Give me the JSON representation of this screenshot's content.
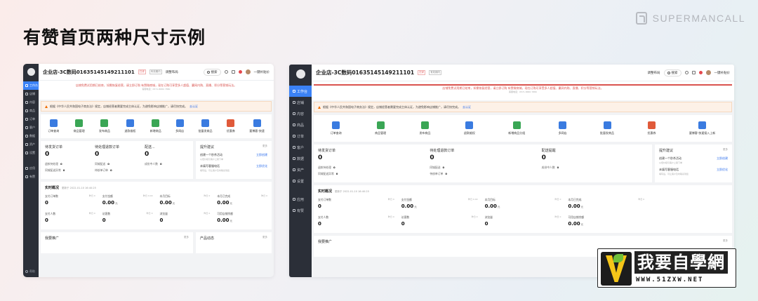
{
  "slide": {
    "title": "有赞首页两种尺寸示例",
    "brand": "SUPERMANCALL"
  },
  "colors": {
    "sidebar_bg": "#2b2f38",
    "sidebar_active": "#3b82f6",
    "notice_red": "#d9534f",
    "warn_bg": "#fdf1e7",
    "link_blue": "#2f6fec"
  },
  "small": {
    "sidebar": [
      {
        "label": "工作台",
        "icon": "workbench-icon",
        "active": true
      },
      {
        "label": "店铺",
        "icon": "store-icon"
      },
      {
        "label": "内容",
        "icon": "content-icon"
      },
      {
        "label": "商品",
        "icon": "goods-icon"
      },
      {
        "label": "订单",
        "icon": "order-icon"
      },
      {
        "label": "客户",
        "icon": "customer-icon"
      },
      {
        "label": "数据",
        "icon": "data-icon"
      },
      {
        "label": "资产",
        "icon": "asset-icon"
      },
      {
        "label": "设置",
        "icon": "settings-icon"
      },
      {
        "label": "应用",
        "icon": "apps-icon"
      },
      {
        "label": "有赞",
        "icon": "youzan-icon"
      }
    ],
    "sidebar_footer": "帮助",
    "topbar": {
      "store": "企业店-3C数码01635145149211101",
      "tag1": "打烊",
      "tag2": "有效期内",
      "notice_link": "调整布局",
      "search": "搜索",
      "user": "一键补贴价"
    },
    "notice": {
      "text": "店铺免费试用期已结束，如需恢复经营，请立即订购 有赞微商城，现在订购可享受多人超值、赢网内购、直播、积分等营销玩法。",
      "sub": "客服电话：0571-8680 7880"
    },
    "warn": {
      "text": "根据《中华人民共和国电子商务法》规定，店铺经营者需要完成主体认证，为避免影响店铺推广，请尽快完成。",
      "link": "去认证"
    },
    "quick": [
      {
        "label": "订单查询",
        "icon": "order-search-icon",
        "color": "#3a7be0"
      },
      {
        "label": "商品管理",
        "icon": "goods-manage-icon",
        "color": "#3aa655"
      },
      {
        "label": "发布商品",
        "icon": "publish-goods-icon",
        "color": "#3aa655"
      },
      {
        "label": "退款维权",
        "icon": "refund-icon",
        "color": "#3a7be0"
      },
      {
        "label": "新增商品",
        "icon": "new-goods-icon",
        "color": "#3aa655"
      },
      {
        "label": "多网店",
        "icon": "multi-store-icon",
        "color": "#3a7be0"
      },
      {
        "label": "批量发商品",
        "icon": "batch-goods-icon",
        "color": "#3a7be0"
      },
      {
        "label": "优惠券",
        "icon": "coupon-icon",
        "color": "#e05a3a"
      },
      {
        "label": "要博客-快速",
        "icon": "blog-icon",
        "color": "#3a7be0"
      }
    ],
    "orders": [
      {
        "title": "待发货订单",
        "value": "0",
        "subs": [
          {
            "label": "退款待处理",
            "value": "0"
          },
          {
            "label": "同城配送异常",
            "value": "0"
          }
        ]
      },
      {
        "title": "待处理退款订单",
        "value": "0",
        "subs": [
          {
            "label": "同城配送",
            "value": "0"
          },
          {
            "label": "待核单订单",
            "value": "0"
          }
        ]
      },
      {
        "title": "配送...",
        "value": "0",
        "subs": [
          {
            "label": "成份中人数",
            "value": "0"
          }
        ]
      }
    ],
    "tips": {
      "title": "提升建议",
      "more": "更多",
      "items": [
        {
          "title": "创建一个秒杀活动",
          "action": "立即创建",
          "desc": "以低价吸引客户上架下单"
        },
        {
          "title": "未填写客服电话",
          "action": "立即优化",
          "desc": "填写后，可让客户及时联系到您"
        }
      ]
    },
    "realtime": {
      "title": "实时概况",
      "time": "更新于 2022-01-10 16:40:25",
      "metrics": [
        {
          "label": "支付订单数",
          "note": "昨日 0",
          "value": "0",
          "unit": ""
        },
        {
          "label": "支付金额",
          "note": "昨日 0.00",
          "value": "0.00",
          "unit": "元"
        },
        {
          "label": "本月目标",
          "note": "昨日 0",
          "value": "0.00",
          "unit": "元"
        },
        {
          "label": "本月已完成",
          "note": "昨日 0",
          "value": "0.00",
          "unit": "元"
        },
        {
          "label": "支付人数",
          "note": "昨日 0",
          "value": "0",
          "unit": ""
        },
        {
          "label": "访客数",
          "note": "昨日 0",
          "value": "0",
          "unit": ""
        },
        {
          "label": "浏览量",
          "note": "昨日 0",
          "value": "0",
          "unit": ""
        },
        {
          "label": "可用店铺余额",
          "note": "",
          "value": "0.00",
          "unit": "元"
        }
      ]
    },
    "bottom": {
      "promo": "我要推广",
      "promo_more": "更多",
      "dynamics": "产品动态",
      "dynamics_more": "更多"
    }
  },
  "large": {
    "sidebar": [
      {
        "label": "工作台",
        "icon": "workbench-icon",
        "active": true
      },
      {
        "label": "店铺",
        "icon": "store-icon"
      },
      {
        "label": "内容",
        "icon": "content-icon"
      },
      {
        "label": "商品",
        "icon": "goods-icon"
      },
      {
        "label": "订单",
        "icon": "order-icon"
      },
      {
        "label": "客户",
        "icon": "customer-icon"
      },
      {
        "label": "数据",
        "icon": "data-icon"
      },
      {
        "label": "资产",
        "icon": "asset-icon"
      },
      {
        "label": "设置",
        "icon": "settings-icon"
      },
      {
        "label": "应用",
        "icon": "apps-icon"
      },
      {
        "label": "有赞",
        "icon": "youzan-icon"
      }
    ],
    "topbar": {
      "store": "企业店-3C数码01635145149211101",
      "tag1": "打烊",
      "tag2": "有效期内",
      "notice_link": "调整布局",
      "search": "搜索",
      "user": "一键补贴价"
    },
    "notice": {
      "text": "店铺免费试用期已结束，如需恢复经营，请立即订购 有赞微商城，现在订购可享受多人超值、赢网内购、直播、积分等营销玩法。",
      "sub": "客服电话：0571-8680 7880"
    },
    "warn": {
      "text": "根据《中华人民共和国电子商务法》规定，店铺经营者需要完成主体认证，为避免影响店铺推广，请尽快完成。",
      "link": "去认证"
    },
    "quick": [
      {
        "label": "订单查询",
        "icon": "order-search-icon",
        "color": "#3a7be0"
      },
      {
        "label": "商品管理",
        "icon": "goods-manage-icon",
        "color": "#3aa655"
      },
      {
        "label": "发布商品",
        "icon": "publish-goods-icon",
        "color": "#3aa655"
      },
      {
        "label": "退款维权",
        "icon": "refund-icon",
        "color": "#3a7be0"
      },
      {
        "label": "新增商品分组",
        "icon": "new-goods-icon",
        "color": "#3aa655"
      },
      {
        "label": "多网店",
        "icon": "multi-store-icon",
        "color": "#3a7be0"
      },
      {
        "label": "批量发商品",
        "icon": "batch-goods-icon",
        "color": "#3a7be0"
      },
      {
        "label": "优惠券",
        "icon": "coupon-icon",
        "color": "#e05a3a"
      },
      {
        "label": "要博客-快速接入上新",
        "icon": "blog-icon",
        "color": "#3a7be0"
      }
    ],
    "orders": [
      {
        "title": "待发货订单",
        "value": "0",
        "subs": [
          {
            "label": "退款待处理",
            "value": "0"
          },
          {
            "label": "同城配送异常",
            "value": "0"
          }
        ]
      },
      {
        "title": "待处理退款订单",
        "value": "0",
        "subs": [
          {
            "label": "同城配送",
            "value": "0"
          },
          {
            "label": "待核单订单",
            "value": "0"
          }
        ]
      },
      {
        "title": "配送提醒",
        "value": "0",
        "subs": [
          {
            "label": "成份中人数",
            "value": "0"
          }
        ]
      }
    ],
    "tips": {
      "title": "提升建议",
      "more": "更多",
      "items": [
        {
          "title": "创建一个秒杀活动",
          "action": "立即创建",
          "desc": "以低价吸引客户上架下单"
        },
        {
          "title": "未填写客服电话",
          "action": "立即优化",
          "desc": "填写后，可让客户及时联系到您"
        }
      ]
    },
    "realtime": {
      "title": "实时概况",
      "time": "更新于 2022-01-10 16:40:25",
      "metrics": [
        {
          "label": "支付订单数",
          "note": "昨日 0",
          "value": "0",
          "unit": ""
        },
        {
          "label": "支付金额",
          "note": "昨日 0.00",
          "value": "0.00",
          "unit": "元"
        },
        {
          "label": "本月目标",
          "note": "昨日 0",
          "value": "0.00",
          "unit": "元"
        },
        {
          "label": "本月已完成",
          "note": "昨日 0",
          "value": "0.00",
          "unit": "元"
        },
        {
          "label": "",
          "note": "",
          "value": "",
          "unit": ""
        },
        {
          "label": "支付人数",
          "note": "昨日 0",
          "value": "0",
          "unit": ""
        },
        {
          "label": "访客数",
          "note": "昨日 0",
          "value": "0",
          "unit": ""
        },
        {
          "label": "浏览量",
          "note": "昨日 0",
          "value": "0",
          "unit": ""
        },
        {
          "label": "可用店铺余额",
          "note": "",
          "value": "0.00",
          "unit": "元"
        }
      ]
    },
    "bottom": {
      "promo": "我要推广",
      "promo_more": "更多"
    }
  },
  "watermark": {
    "text": "我要自學網",
    "url": "WWW.51ZXW.NET"
  }
}
